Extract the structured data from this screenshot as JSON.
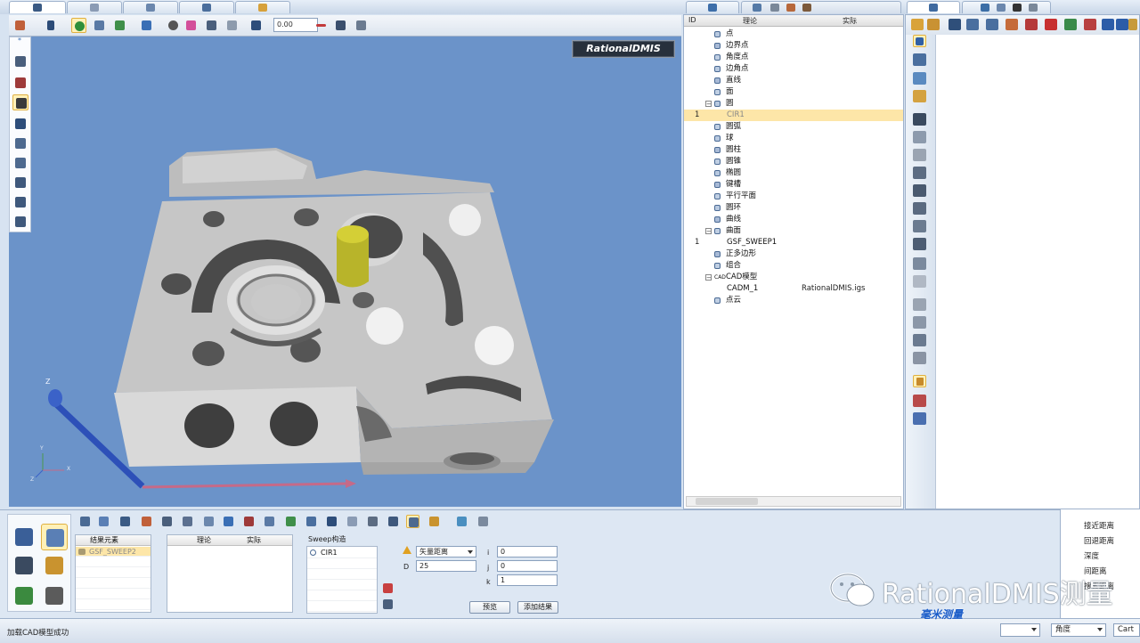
{
  "viewport_toolbar": {
    "numeric_value": "0.00"
  },
  "brand": {
    "label": "RationalDMIS"
  },
  "axes": {
    "z_label": "Z",
    "mini_y": "Y",
    "mini_x": "X",
    "mini_z": "Z"
  },
  "tree": {
    "headers": {
      "id": "ID",
      "nominal": "理论",
      "actual": "实际"
    },
    "rows": [
      {
        "id": "",
        "label": "点",
        "actual": "",
        "indent": 1
      },
      {
        "id": "",
        "label": "边界点",
        "actual": "",
        "indent": 1
      },
      {
        "id": "",
        "label": "角度点",
        "actual": "",
        "indent": 1
      },
      {
        "id": "",
        "label": "边角点",
        "actual": "",
        "indent": 1
      },
      {
        "id": "",
        "label": "直线",
        "actual": "",
        "indent": 1
      },
      {
        "id": "",
        "label": "面",
        "actual": "",
        "indent": 1
      },
      {
        "id": "",
        "label": "圆",
        "actual": "",
        "indent": 1,
        "expander": "⊟"
      },
      {
        "id": "1",
        "label": "CIR1",
        "actual": "",
        "indent": 2,
        "highlight": true
      },
      {
        "id": "",
        "label": "圆弧",
        "actual": "",
        "indent": 1
      },
      {
        "id": "",
        "label": "球",
        "actual": "",
        "indent": 1
      },
      {
        "id": "",
        "label": "圆柱",
        "actual": "",
        "indent": 1
      },
      {
        "id": "",
        "label": "圆锥",
        "actual": "",
        "indent": 1
      },
      {
        "id": "",
        "label": "椭圆",
        "actual": "",
        "indent": 1
      },
      {
        "id": "",
        "label": "键槽",
        "actual": "",
        "indent": 1
      },
      {
        "id": "",
        "label": "平行平面",
        "actual": "",
        "indent": 1
      },
      {
        "id": "",
        "label": "圆环",
        "actual": "",
        "indent": 1
      },
      {
        "id": "",
        "label": "曲线",
        "actual": "",
        "indent": 1
      },
      {
        "id": "",
        "label": "曲面",
        "actual": "",
        "indent": 1,
        "expander": "⊟"
      },
      {
        "id": "1",
        "label": "GSF_SWEEP1",
        "actual": "",
        "indent": 2
      },
      {
        "id": "",
        "label": "正多边形",
        "actual": "",
        "indent": 1
      },
      {
        "id": "",
        "label": "组合",
        "actual": "",
        "indent": 1
      },
      {
        "id": "",
        "label": "CAD模型",
        "actual": "",
        "indent": 1,
        "expander": "⊟",
        "prefix": "CAD"
      },
      {
        "id": "",
        "label": "CADM_1",
        "actual": "RationalDMIS.igs",
        "indent": 2
      },
      {
        "id": "",
        "label": "点云",
        "actual": "",
        "indent": 1
      }
    ]
  },
  "construct": {
    "result_header": "结果元素",
    "result_value": "GSF_SWEEP2",
    "nominal_header": "理论",
    "actual_header": "实际",
    "sweep_header": "Sweep构造",
    "sweep_item": "CIR1",
    "vector_mode": "矢量距离",
    "d_label": "D",
    "d_value": "25",
    "i_label": "i",
    "i_value": "0",
    "j_label": "j",
    "j_value": "0",
    "k_label": "k",
    "k_value": "1",
    "preview_button": "预览",
    "add_result_button": "添加结果"
  },
  "right_options": [
    "接近距离",
    "回退距离",
    "深度",
    "间距离",
    "搜索距离"
  ],
  "status": {
    "message": "加载CAD模型成功",
    "units": "角度",
    "coord": "Cart"
  },
  "watermark": {
    "text": "RationalDMIS测量",
    "badge": "毫米测量"
  },
  "colors": {
    "viewport_bg": "#6b93c9",
    "highlight": "#fde6a8",
    "part": "#c0c0c0",
    "cylinder": "#c9c427"
  }
}
